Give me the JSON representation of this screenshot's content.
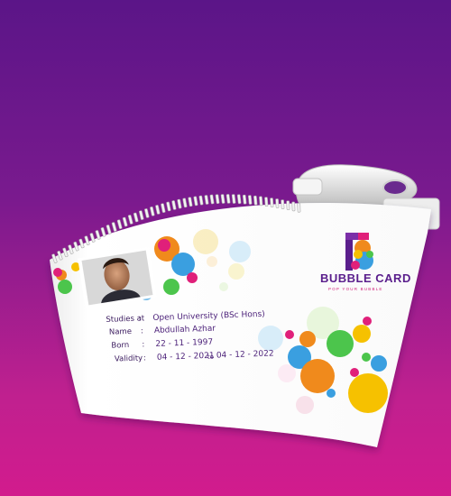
{
  "brand": {
    "logo_letter": "B",
    "name": "BUBBLE CARD",
    "tagline": "POP YOUR BUBBLE"
  },
  "card": {
    "fields": [
      {
        "label": "Studies at",
        "value": "Open University (BSc Hons)"
      },
      {
        "label": "Name",
        "value": "Abdullah Azhar"
      },
      {
        "label": "Born",
        "value": "22 - 11 - 1997"
      },
      {
        "label": "Validity",
        "value_from": "04 - 12 - 2021",
        "connector": "to",
        "value_to": "04 - 12 - 2022"
      }
    ]
  },
  "colors": {
    "background_top": "#5b1588",
    "background_bottom": "#d21b8d",
    "brand_purple": "#5a1e8c",
    "tagline_pink": "#d0207a"
  }
}
